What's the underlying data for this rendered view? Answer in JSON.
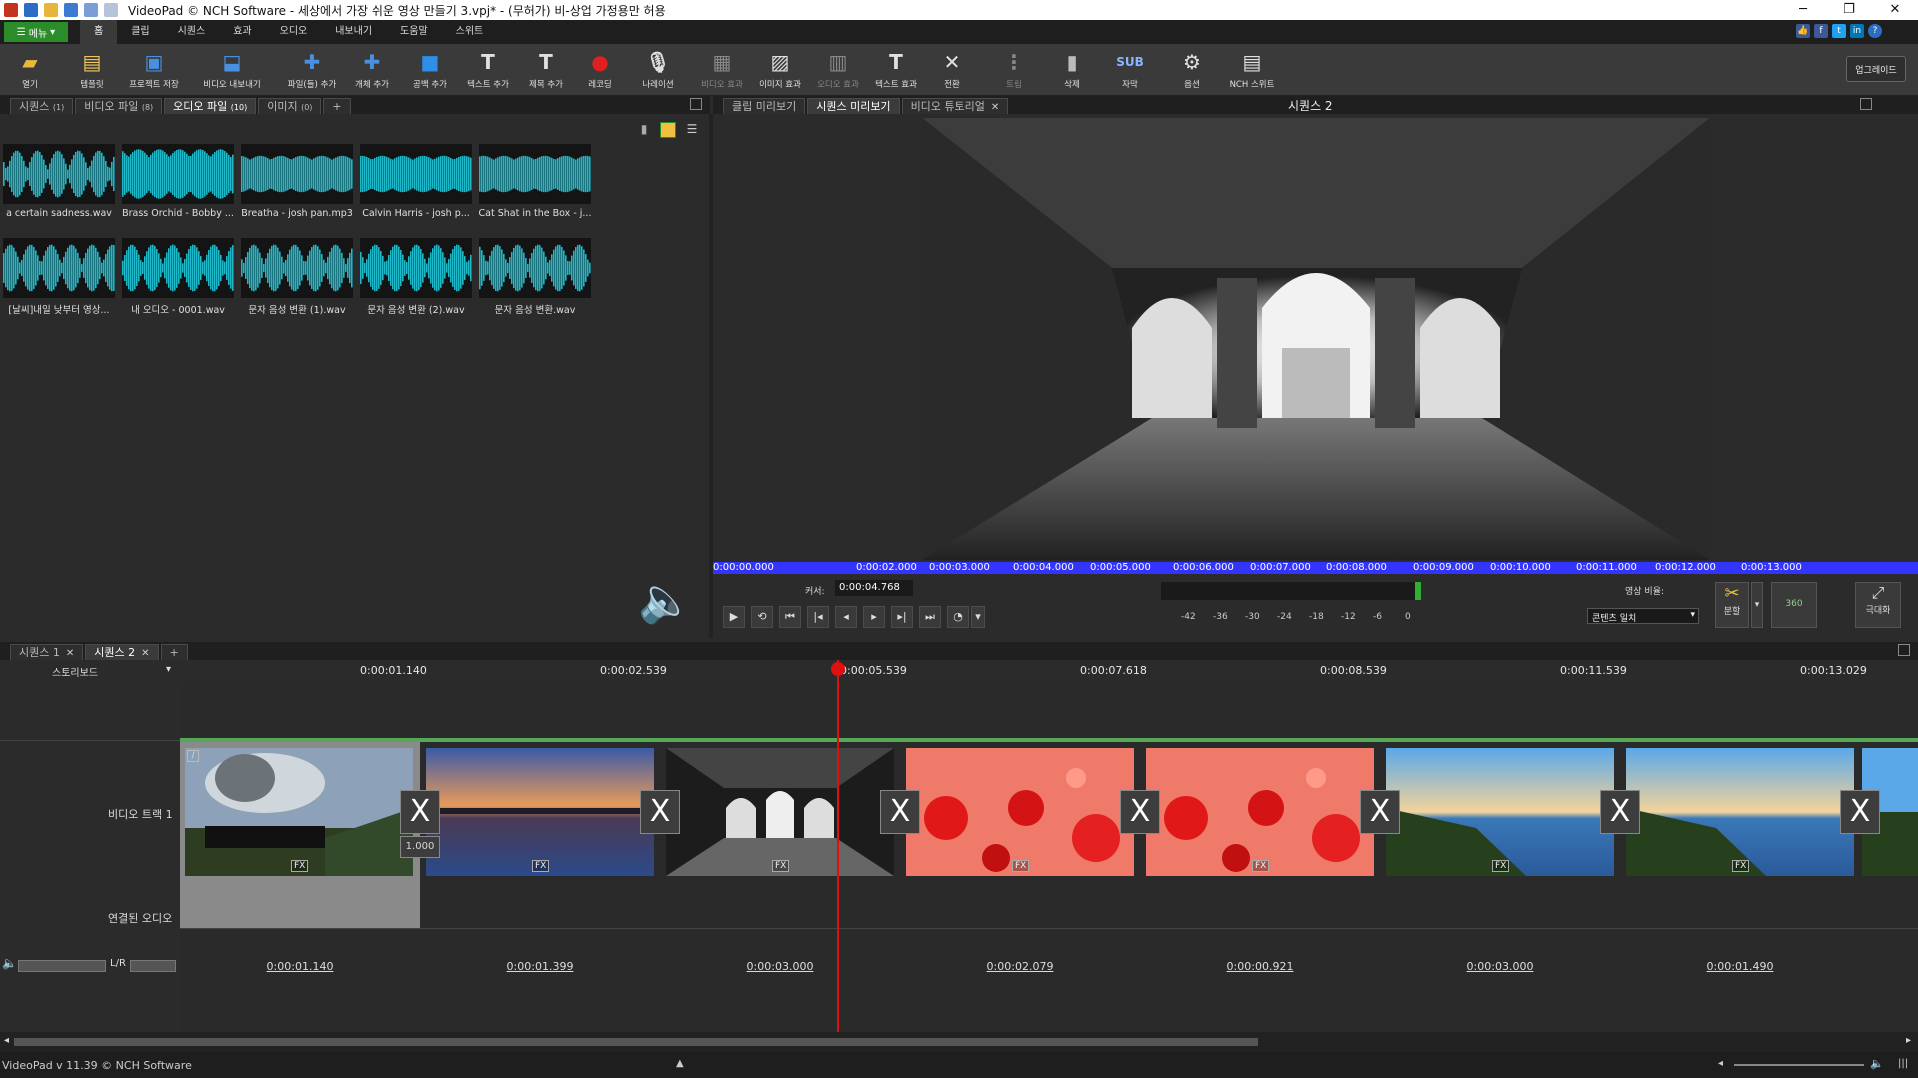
{
  "window": {
    "title": "VideoPad © NCH Software - 세상에서 가장 쉬운 영상 만들기 3.vpj* - (무허가) 비-상업 가정용만 허용",
    "minimize": "─",
    "restore": "❐",
    "close": "✕"
  },
  "menu": {
    "menu_button": "메뉴",
    "tabs": [
      "홈",
      "클립",
      "시퀀스",
      "효과",
      "오디오",
      "내보내기",
      "도움말",
      "스위트"
    ],
    "active_tab": "홈"
  },
  "toolbar": {
    "items": [
      {
        "label": "열기",
        "icon": "folder-open-icon"
      },
      {
        "label": "템플릿",
        "icon": "template-icon"
      },
      {
        "label": "프로젝트 저장",
        "icon": "save-icon"
      },
      {
        "label": "비디오 내보내기",
        "icon": "export-video-icon"
      },
      {
        "label": "파일(들) 추가",
        "icon": "add-files-icon"
      },
      {
        "label": "개체 추가",
        "icon": "add-object-icon"
      },
      {
        "label": "공백 추가",
        "icon": "add-blank-icon"
      },
      {
        "label": "텍스트 추가",
        "icon": "add-text-icon"
      },
      {
        "label": "제목 추가",
        "icon": "add-title-icon"
      },
      {
        "label": "레코딩",
        "icon": "record-icon"
      },
      {
        "label": "나레이션",
        "icon": "narration-mic-icon"
      },
      {
        "label": "비디오 효과",
        "icon": "video-effects-icon"
      },
      {
        "label": "이미지 효과",
        "icon": "image-effects-icon"
      },
      {
        "label": "오디오 효과",
        "icon": "audio-effects-icon"
      },
      {
        "label": "텍스트 효과",
        "icon": "text-effects-icon"
      },
      {
        "label": "전환",
        "icon": "transition-icon"
      },
      {
        "label": "트림",
        "icon": "trim-icon"
      },
      {
        "label": "삭제",
        "icon": "trash-icon"
      },
      {
        "label": "자막",
        "icon": "subtitle-icon"
      },
      {
        "label": "옵션",
        "icon": "options-icon"
      },
      {
        "label": "NCH 스위트",
        "icon": "nch-suite-icon"
      }
    ],
    "upgrade": "업그레이드"
  },
  "bins": {
    "tabs": [
      {
        "label": "시퀀스",
        "count": "(1)"
      },
      {
        "label": "비디오 파일",
        "count": "(8)"
      },
      {
        "label": "오디오 파일",
        "count": "(10)"
      },
      {
        "label": "이미지",
        "count": "(0)"
      }
    ],
    "add_tab": "+",
    "active_tab": "오디오 파일",
    "audio_files": [
      "a certain sadness.wav",
      "Brass Orchid - Bobby ...",
      "Breatha - josh pan.mp3",
      "Calvin Harris - josh p...",
      "Cat Shat in the Box - j...",
      "[날씨]내일 낮부터 영상...",
      "내 오디오 - 0001.wav",
      "문자 음성 변환 (1).wav",
      "문자 음성 변환 (2).wav",
      "문자 음성 변환.wav"
    ],
    "waveform_color": "#1fb8c8"
  },
  "preview": {
    "tabs": [
      "클립 미리보기",
      "시퀀스 미리보기",
      "비디오 튜토리얼"
    ],
    "active_tab": "시퀀스 미리보기",
    "sequence_title": "시퀀스 2",
    "ruler_ticks": [
      "0:00:00.000",
      "0:00:02.000",
      "0:00:03.000",
      "0:00:04.000",
      "0:00:05.000",
      "0:00:06.000",
      "0:00:07.000",
      "0:00:08.000",
      "0:00:09.000",
      "0:00:10.000",
      "0:00:11.000",
      "0:00:12.000",
      "0:00:13.000"
    ],
    "cursor_label": "커서:",
    "cursor_value": "0:00:04.768",
    "meter_ticks": [
      "-42",
      "-36",
      "-30",
      "-24",
      "-18",
      "-12",
      "-6",
      "0"
    ],
    "aspect_label": "영상 비율:",
    "aspect_value": "콘텐츠 일치",
    "split_label": "분할",
    "vr_label": "360",
    "fullscreen_label": "극대화",
    "ruler_color": "#3434ff"
  },
  "timeline": {
    "tabs": [
      "시퀀스 1",
      "시퀀스 2"
    ],
    "active_tab": "시퀀스 2",
    "add_tab": "+",
    "view_mode": "스토리보드",
    "ruler_ticks": [
      "0:00:01.140",
      "0:00:02.539",
      "0:00:05.539",
      "0:00:07.618",
      "0:00:08.539",
      "0:00:11.539",
      "0:00:13.029"
    ],
    "video_track_label": "비디오 트랙 1",
    "linked_audio_label": "연결된 오디오",
    "lr_label": "L/R",
    "transition_value": "1.000",
    "fx_label": "FX",
    "transition_icon": "X",
    "clip_durations": [
      "0:00:01.140",
      "0:00:01.399",
      "0:00:03.000",
      "0:00:02.079",
      "0:00:00.921",
      "0:00:03.000",
      "0:00:01.490"
    ],
    "playhead_color": "#e01010"
  },
  "status": {
    "version": "VideoPad v 11.39 © NCH Software"
  }
}
